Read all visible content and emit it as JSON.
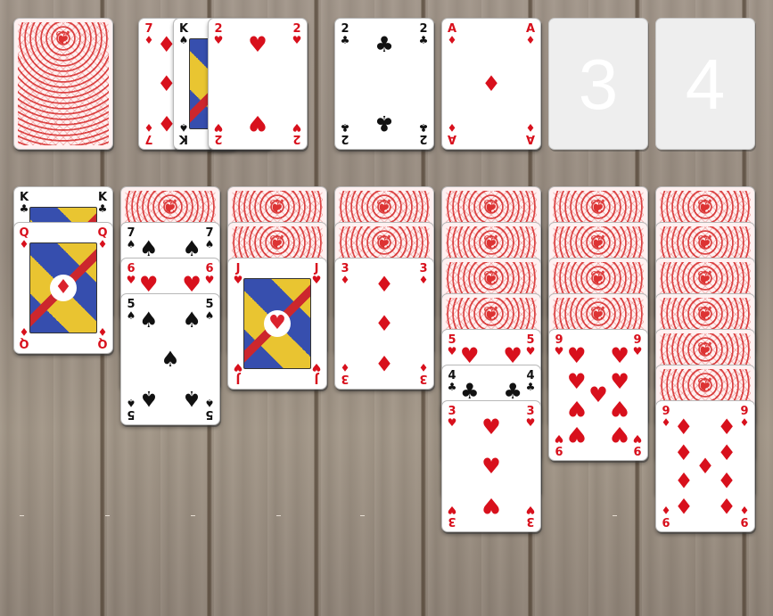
{
  "stock": {
    "face_down": true
  },
  "waste": [
    {
      "rank": "7",
      "suit": "♦",
      "color": "red"
    },
    {
      "rank": "K",
      "suit": "♠",
      "color": "black"
    },
    {
      "rank": "2",
      "suit": "♥",
      "color": "red"
    }
  ],
  "foundations": [
    {
      "label": "",
      "top": {
        "rank": "2",
        "suit": "♣",
        "color": "black"
      }
    },
    {
      "label": "",
      "top": {
        "rank": "A",
        "suit": "♦",
        "color": "red"
      }
    },
    {
      "label": "3",
      "top": null
    },
    {
      "label": "4",
      "top": null
    }
  ],
  "tableau": [
    {
      "face_down": 0,
      "cards": [
        {
          "rank": "K",
          "suit": "♣",
          "color": "black"
        },
        {
          "rank": "Q",
          "suit": "♦",
          "color": "red"
        }
      ]
    },
    {
      "face_down": 1,
      "cards": [
        {
          "rank": "7",
          "suit": "♠",
          "color": "black"
        },
        {
          "rank": "6",
          "suit": "♥",
          "color": "red"
        },
        {
          "rank": "5",
          "suit": "♠",
          "color": "black"
        }
      ]
    },
    {
      "face_down": 2,
      "cards": [
        {
          "rank": "J",
          "suit": "♥",
          "color": "red"
        }
      ]
    },
    {
      "face_down": 2,
      "cards": [
        {
          "rank": "3",
          "suit": "♦",
          "color": "red"
        }
      ]
    },
    {
      "face_down": 4,
      "cards": [
        {
          "rank": "5",
          "suit": "♥",
          "color": "red"
        },
        {
          "rank": "4",
          "suit": "♣",
          "color": "black"
        },
        {
          "rank": "3",
          "suit": "♥",
          "color": "red"
        }
      ]
    },
    {
      "face_down": 4,
      "cards": [
        {
          "rank": "9",
          "suit": "♥",
          "color": "red"
        }
      ]
    },
    {
      "face_down": 6,
      "cards": [
        {
          "rank": "9",
          "suit": "♦",
          "color": "red"
        }
      ]
    }
  ],
  "theme": {
    "red_suit": "#d8101c",
    "black_suit": "#111111",
    "card_back_color": "#d33333",
    "empty_slot": "#eeeeee",
    "table": "wood"
  }
}
